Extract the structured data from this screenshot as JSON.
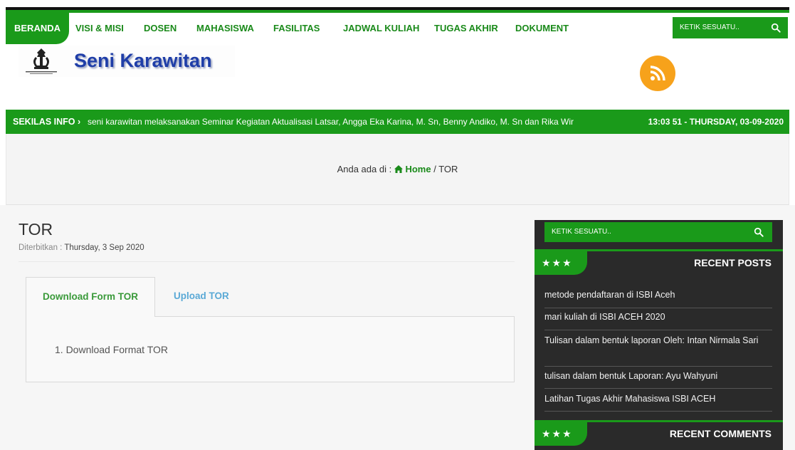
{
  "nav": {
    "items": [
      {
        "label": "BERANDA",
        "active": true
      },
      {
        "label": "VISI & MISI"
      },
      {
        "label": "DOSEN"
      },
      {
        "label": "MAHASISWA"
      },
      {
        "label": "FASILITAS"
      },
      {
        "label": "JADWAL KULIAH"
      },
      {
        "label": "TUGAS AKHIR"
      },
      {
        "label": "DOKUMENT"
      }
    ],
    "search_placeholder": "KETIK SESUATU.."
  },
  "header": {
    "site_title": "Seni Karawitan"
  },
  "ticker": {
    "label": "SEKILAS INFO ›",
    "text": "seni karawitan melaksanakan Seminar Kegiatan Aktualisasi Latsar, Angga Eka Karina, M. Sn, Benny Andiko, M. Sn dan Rika Wir",
    "time": "13:03 51 - THURSDAY, 03-09-2020"
  },
  "breadcrumb": {
    "prefix": "Anda ada di :",
    "home": "Home",
    "separator": "/",
    "current": "TOR"
  },
  "post": {
    "title": "TOR",
    "published_label": "Diterbitkan :",
    "published_date": "Thursday, 3 Sep 2020",
    "tabs": [
      {
        "label": "Download Form TOR",
        "active": true
      },
      {
        "label": "Upload TOR"
      }
    ],
    "list": [
      "1. Download Format TOR"
    ]
  },
  "sidebar": {
    "search_placeholder": "KETIK SESUATU..",
    "stars": "★★★",
    "recent_posts_title": "RECENT POSTS",
    "recent_posts": [
      "metode pendaftaran di ISBI Aceh",
      "mari kuliah di ISBI ACEH 2020",
      "Tulisan dalam bentuk laporan Oleh: Intan Nirmala Sari",
      "tulisan dalam bentuk Laporan: Ayu Wahyuni",
      "Latihan Tugas Akhir Mahasiswa ISBI ACEH"
    ],
    "recent_comments_title": "RECENT COMMENTS"
  },
  "colors": {
    "brand_green": "#1a9a1a",
    "title_blue": "#1f3ea8",
    "rss_orange": "#f7a21b",
    "sidebar_dark": "#2a2a2a",
    "tab_link_blue": "#5aa9d6"
  },
  "icons": {
    "search": "search-icon",
    "home": "home-icon",
    "rss": "rss-icon",
    "logo": "institution-emblem-icon"
  }
}
